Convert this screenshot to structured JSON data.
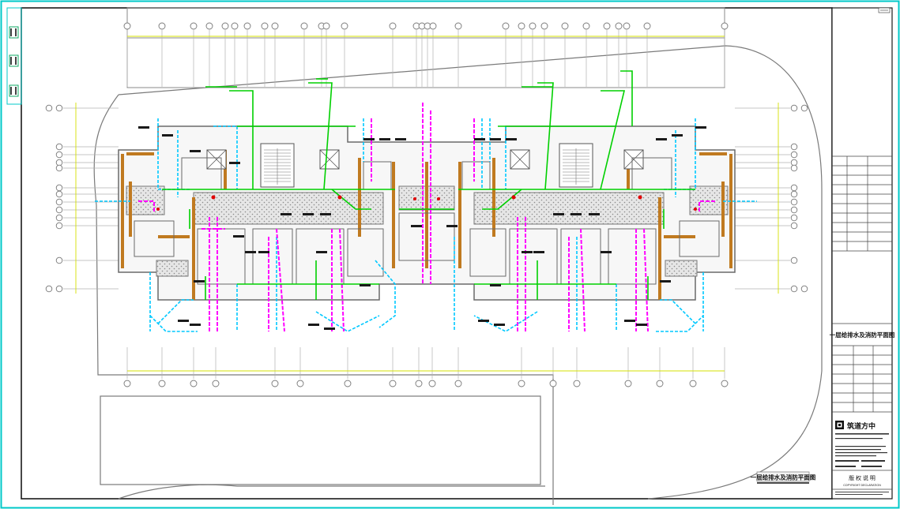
{
  "drawing": {
    "plan_title": "一层给排水及消防平面图",
    "title_block": {
      "sheet_name": "一层给排水及消防平面图",
      "company_name": "筑道方中",
      "copyright_cn": "版 权 说 明",
      "copyright_en": "COPYRIGHT DECLARATION"
    }
  },
  "colors": {
    "background": "#ffffff",
    "frame": "#00c8c8",
    "inner_frame": "#1a1a1a",
    "wall": "#808080",
    "column": "#c07a20",
    "water_pipe": "#00c8ff",
    "drain_pipe": "#ff00ff",
    "fire_pipe": "#00d000",
    "axis": "#b0b0b0",
    "axis_label": "#777777",
    "dim_line": "#d4e000",
    "hatch": "#bdbdbd"
  }
}
